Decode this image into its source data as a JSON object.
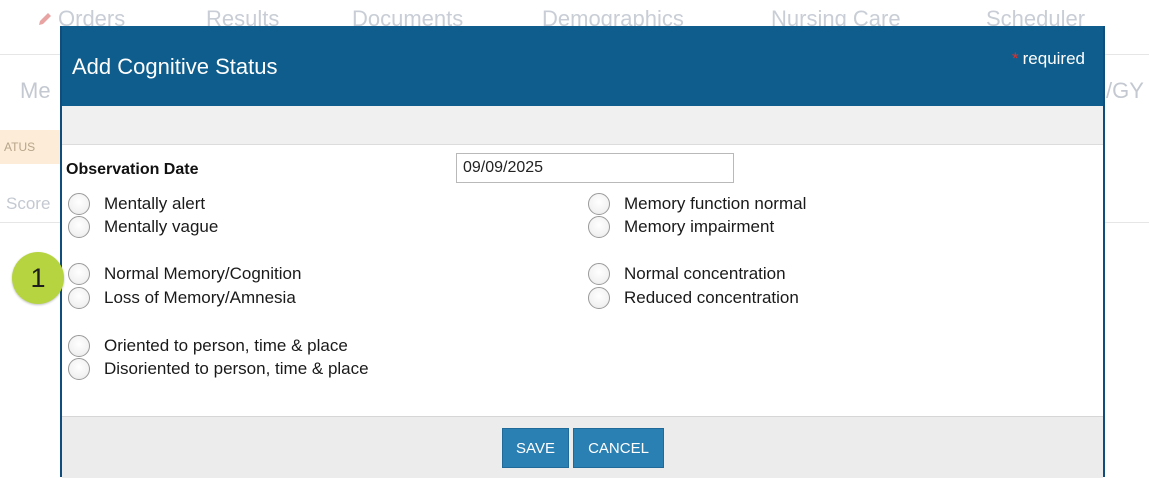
{
  "background": {
    "tabs": [
      "Orders",
      "Results",
      "Documents",
      "Demographics",
      "Nursing Care",
      "Scheduler"
    ],
    "sub_left": "Me",
    "sub_right": "/GY",
    "status_chip": "ATUS",
    "score_label": "Score"
  },
  "step_marker": "1",
  "dialog": {
    "title": "Add Cognitive Status",
    "required_star": "*",
    "required_text": "required",
    "observation_date_label": "Observation Date",
    "observation_date_value": "09/09/2025",
    "options_left": [
      "Mentally alert",
      "Mentally vague",
      "Normal Memory/Cognition",
      "Loss of Memory/Amnesia",
      "Oriented to person, time & place",
      "Disoriented to person, time & place"
    ],
    "options_right": [
      "Memory function normal",
      "Memory impairment",
      "Normal concentration",
      "Reduced concentration"
    ],
    "save_label": "SAVE",
    "cancel_label": "CANCEL"
  },
  "colors": {
    "header": "#0f5d8c",
    "button": "#2a7fb3",
    "marker": "#b6d43f",
    "required_star": "#e0302a"
  }
}
